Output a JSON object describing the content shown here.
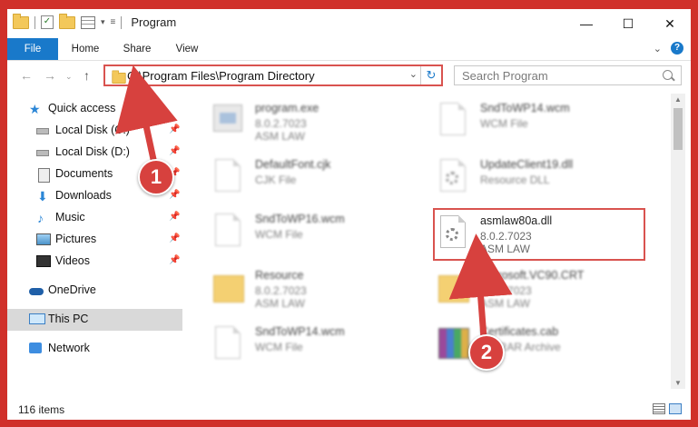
{
  "window": {
    "title": "Program",
    "controls": {
      "minimize": "—",
      "maximize": "☐",
      "close": "✕"
    }
  },
  "ribbon": {
    "tabs": [
      "File",
      "Home",
      "Share",
      "View"
    ]
  },
  "address": {
    "path": "C:\\Program Files\\Program Directory",
    "search_placeholder": "Search Program"
  },
  "sidebar": {
    "items": [
      {
        "label": "Quick access",
        "icon": "star-icon",
        "pinned": false
      },
      {
        "label": "Local Disk (C:)",
        "icon": "disk-icon",
        "pinned": true
      },
      {
        "label": "Local Disk (D:)",
        "icon": "disk-icon",
        "pinned": true
      },
      {
        "label": "Documents",
        "icon": "documents-icon",
        "pinned": true
      },
      {
        "label": "Downloads",
        "icon": "downloads-icon",
        "pinned": true
      },
      {
        "label": "Music",
        "icon": "music-icon",
        "pinned": true
      },
      {
        "label": "Pictures",
        "icon": "pictures-icon",
        "pinned": true
      },
      {
        "label": "Videos",
        "icon": "videos-icon",
        "pinned": true
      },
      {
        "label": "OneDrive",
        "icon": "onedrive-icon",
        "pinned": false
      },
      {
        "label": "This PC",
        "icon": "this-pc-icon",
        "pinned": false,
        "selected": true
      },
      {
        "label": "Network",
        "icon": "network-icon",
        "pinned": false
      }
    ]
  },
  "files": [
    {
      "name": "program.exe",
      "line2": "8.0.2.7023",
      "line3": "ASM LAW",
      "icon": "exe-icon",
      "blurred": true
    },
    {
      "name": "SndToWP14.wcm",
      "line2": "WCM File",
      "line3": "",
      "icon": "file-icon",
      "blurred": true
    },
    {
      "name": "DefaultFont.cjk",
      "line2": "CJK File",
      "line3": "",
      "icon": "file-icon",
      "blurred": true
    },
    {
      "name": "UpdateClient19.dll",
      "line2": "Resource DLL",
      "line3": "",
      "icon": "dll-icon",
      "blurred": true
    },
    {
      "name": "SndToWP16.wcm",
      "line2": "WCM File",
      "line3": "",
      "icon": "file-icon",
      "blurred": true
    },
    {
      "name": "asmlaw80a.dll",
      "line2": "8.0.2.7023",
      "line3": "ASM LAW",
      "icon": "dll-icon",
      "blurred": false,
      "highlighted": true
    },
    {
      "name": "Resource",
      "line2": "8.0.2.7023",
      "line3": "ASM LAW",
      "icon": "folder-icon",
      "blurred": true
    },
    {
      "name": "Microsoft.VC90.CRT",
      "line2": "8.0.2.7023",
      "line3": "ASM LAW",
      "icon": "folder-icon",
      "blurred": true
    },
    {
      "name": "SndToWP14.wcm",
      "line2": "WCM File",
      "line3": "",
      "icon": "file-icon",
      "blurred": true
    },
    {
      "name": "Certificates.cab",
      "line2": "WinRAR Archive",
      "line3": "",
      "icon": "archive-icon",
      "blurred": true
    }
  ],
  "status": {
    "item_count": "116 items"
  },
  "annotations": {
    "step1": "1",
    "step2": "2"
  },
  "colors": {
    "accent": "#1979ca",
    "annotation_red": "#d7413e"
  }
}
